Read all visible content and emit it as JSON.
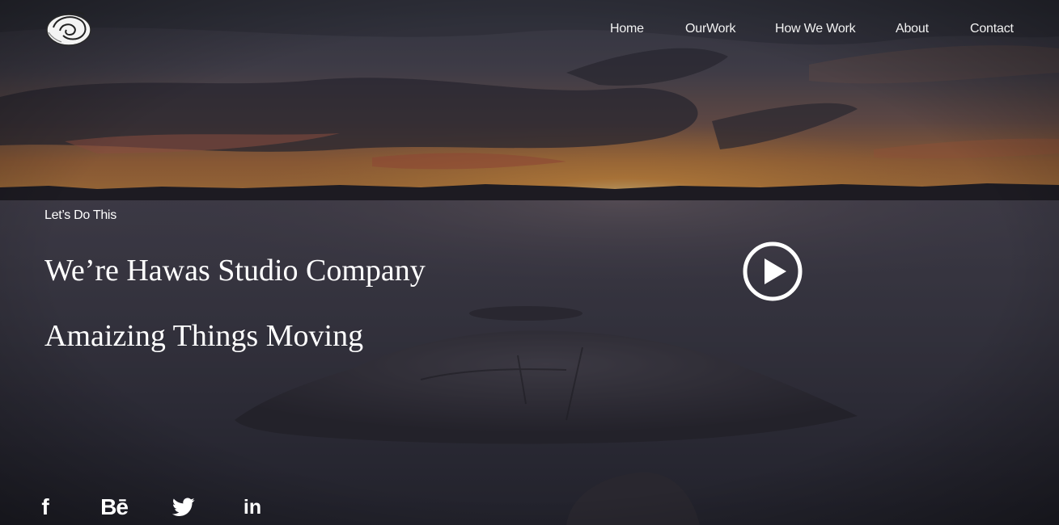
{
  "header": {
    "logo_icon": "hawas-studio-swirl-logo",
    "nav": [
      {
        "label": "Home"
      },
      {
        "label": "OurWork"
      },
      {
        "label": "How We Work"
      },
      {
        "label": "About"
      },
      {
        "label": "Contact"
      }
    ]
  },
  "hero": {
    "tagline": "Let’s Do This",
    "headline_1": "We’re Hawas Studio Company",
    "headline_2": "Amaizing Things Moving",
    "play_icon": "play-circle-icon",
    "background": "sunset-lake-with-rock"
  },
  "social": {
    "facebook": "f",
    "behance": "Bē",
    "twitter_icon": "twitter-bird-icon",
    "linkedin": "in"
  },
  "colors": {
    "text": "#ffffff",
    "overlay": "#1e1e28"
  }
}
